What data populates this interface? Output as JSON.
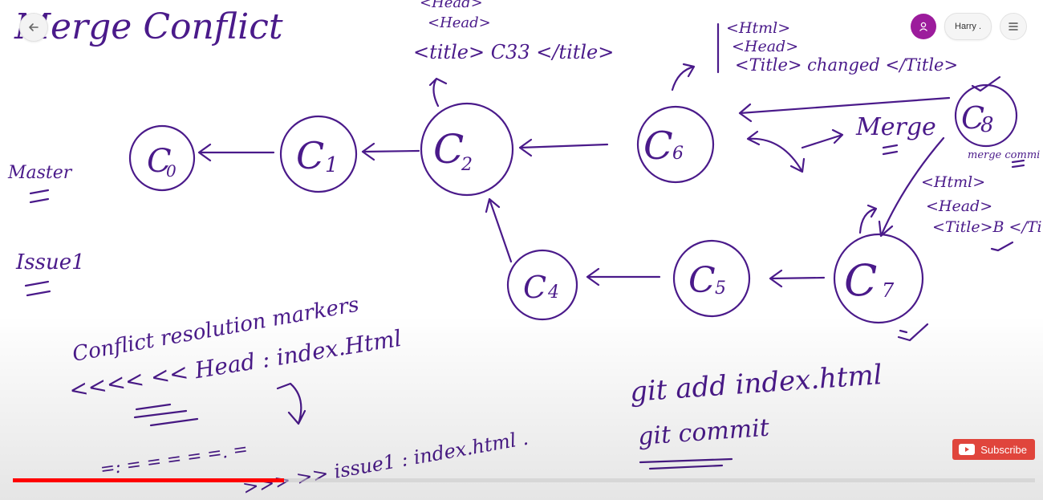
{
  "colors": {
    "ink": "#4a1a8a",
    "avatar": "#9c1c9c",
    "subscribe": "#e0453c",
    "progress": "#ff0000"
  },
  "icons": {
    "back": "arrow-left-icon",
    "avatar": "user-icon",
    "menu": "hamburger-menu-icon",
    "subscribe": "youtube-play-icon"
  },
  "header": {
    "user_name": "Harry ."
  },
  "player": {
    "subscribe_label": "Subscribe",
    "progress": 0.265
  },
  "whiteboard": {
    "title": "Merge Conflict",
    "branches": {
      "master": "Master",
      "issue": "Issue1"
    },
    "nodes": {
      "c0": "C",
      "c0_sub": "0",
      "c1": "C",
      "c1_sub": "1",
      "c2": "C",
      "c2_sub": "2",
      "c4": "C",
      "c4_sub": "4",
      "c5": "C",
      "c5_sub": "5",
      "c6": "C",
      "c6_sub": "6",
      "c7": "C",
      "c7_sub": "7",
      "c8": "C",
      "c8_sub": "8"
    },
    "c2_note": [
      "<Head>",
      "<Head>",
      "<title> C33 </title>"
    ],
    "c6_note": [
      "<Html>",
      "<Head>",
      "<Title> changed </Title>"
    ],
    "c7_note": [
      "<Html>",
      "<Head>",
      "<Title>B </Ti"
    ],
    "merge_label": "Merge",
    "merge_commit_label": "merge commi",
    "conflict": {
      "heading": "Conflict resolution markers",
      "line1": "<<<< << Head : index.Html",
      "line2": "=: = = = = =. =",
      "line3": ">>> >> issue1 : index.html ."
    },
    "git": {
      "add": "git add index.html",
      "commit": "git commit"
    }
  }
}
